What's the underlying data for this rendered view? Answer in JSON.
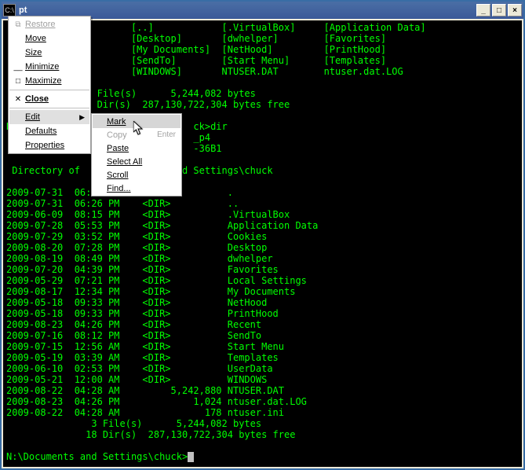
{
  "titlebar": {
    "icon_text": "C:\\",
    "title": "pt",
    "min": "_",
    "max": "□",
    "close": "×"
  },
  "sysmenu": {
    "restore": "Restore",
    "move": "Move",
    "size": "Size",
    "minimize": "Minimize",
    "maximize": "Maximize",
    "close": "Close",
    "edit": "Edit",
    "defaults": "Defaults",
    "properties": "Properties"
  },
  "submenu": {
    "mark": "Mark",
    "copy": "Copy",
    "copy_key": "Enter",
    "paste": "Paste",
    "select_all": "Select All",
    "scroll": "Scroll",
    "find": "Find..."
  },
  "term": {
    "row1_a": "                      [..]            [.VirtualBox]     [Application Data]",
    "row2_a": "                      [Desktop]       [dwhelper]        [Favorites]",
    "row3_a": "              ]       [My Documents]  [NetHood]         [PrintHood]",
    "row4_a": "                      [SendTo]        [Start Menu]      [Templates]",
    "row5_a": "                      [WINDOWS]       NTUSER.DAT        ntuser.dat.LOG",
    "row6_a": "",
    "row7_a": "              3 File(s)      5,244,082 bytes",
    "row8_a": "              8 Dir(s)  287,130,722,304 bytes free",
    "row9_a": "",
    "row10_a": "N                                ck>dir",
    "row11_a": "                                 _p4",
    "row12_a": "                                 -36B1",
    "row13_a": "",
    "row14_a": " Directory of                  d Settings\\chuck",
    "row15_a": "",
    "l01": "2009-07-31  06:26 PM    <DIR>          .",
    "l02": "2009-07-31  06:26 PM    <DIR>          ..",
    "l03": "2009-06-09  08:15 PM    <DIR>          .VirtualBox",
    "l04": "2009-07-28  05:53 PM    <DIR>          Application Data",
    "l05": "2009-07-29  03:52 PM    <DIR>          Cookies",
    "l06": "2009-08-20  07:28 PM    <DIR>          Desktop",
    "l07": "2009-08-19  08:49 PM    <DIR>          dwhelper",
    "l08": "2009-07-20  04:39 PM    <DIR>          Favorites",
    "l09": "2009-05-29  07:21 PM    <DIR>          Local Settings",
    "l10": "2009-08-17  12:34 PM    <DIR>          My Documents",
    "l11": "2009-05-18  09:33 PM    <DIR>          NetHood",
    "l12": "2009-05-18  09:33 PM    <DIR>          PrintHood",
    "l13": "2009-08-23  04:26 PM    <DIR>          Recent",
    "l14": "2009-07-16  08:12 PM    <DIR>          SendTo",
    "l15": "2009-07-15  12:56 AM    <DIR>          Start Menu",
    "l16": "2009-05-19  03:39 AM    <DIR>          Templates",
    "l17": "2009-06-10  02:53 PM    <DIR>          UserData",
    "l18": "2009-05-21  12:00 AM    <DIR>          WINDOWS",
    "l19": "2009-08-22  04:28 AM         5,242,880 NTUSER.DAT",
    "l20": "2009-08-23  04:26 PM             1,024 ntuser.dat.LOG",
    "l21": "2009-08-22  04:28 AM               178 ntuser.ini",
    "sum1": "               3 File(s)      5,244,082 bytes",
    "sum2": "              18 Dir(s)  287,130,722,304 bytes free",
    "blank": "",
    "prompt": "N:\\Documents and Settings\\chuck>"
  }
}
